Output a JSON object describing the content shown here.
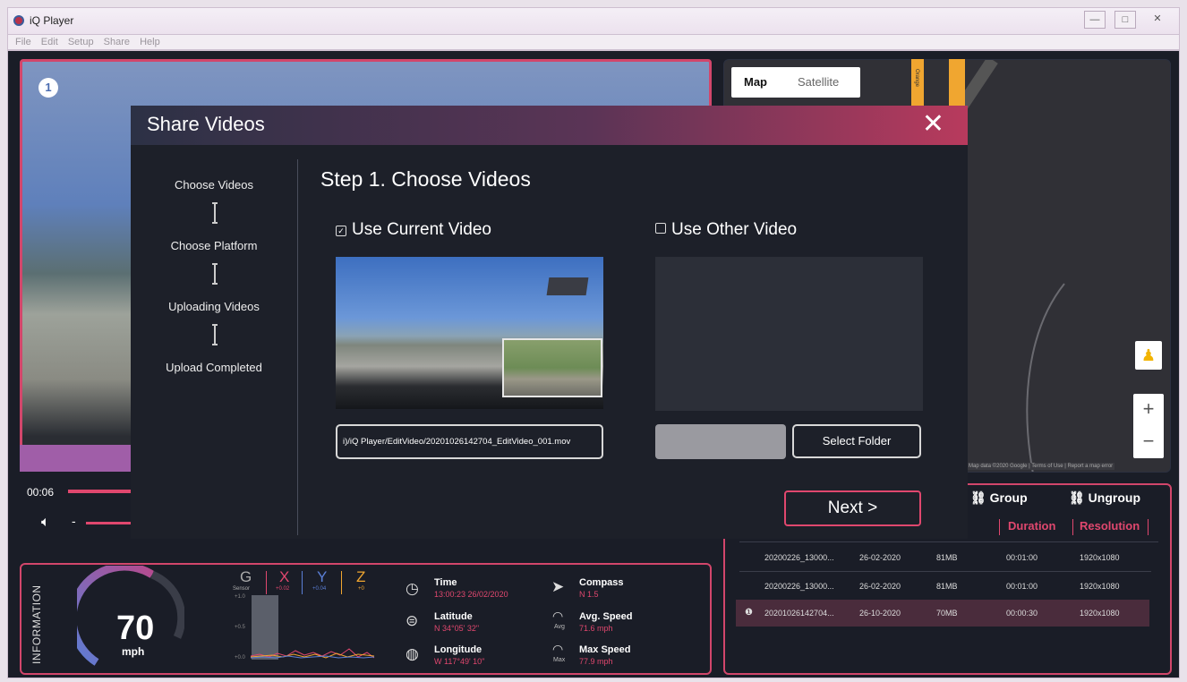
{
  "window": {
    "title": "iQ Player",
    "min": "—",
    "max": "□",
    "close": "✕"
  },
  "menu": [
    "File",
    "Edit",
    "Setup",
    "Share",
    "Help"
  ],
  "video": {
    "camera_number": "1",
    "time": "00:06",
    "volume_dash": "-"
  },
  "map": {
    "tab_map": "Map",
    "tab_satellite": "Satellite",
    "zoom_in": "+",
    "zoom_out": "−",
    "attribution": "Map data ©2020 Google | Terms of Use | Report a map error",
    "road_label": "Orange"
  },
  "modal": {
    "title": "Share Videos",
    "close": "✕",
    "steps": [
      "Choose Videos",
      "Choose Platform",
      "Uploading Videos",
      "Upload Completed"
    ],
    "step_heading": "Step 1. Choose Videos",
    "use_current": "Use Current Video",
    "use_current_checked": true,
    "use_other": "Use Other Video",
    "use_other_checked": false,
    "current_path": "i)/iQ Player/EditVideo/20201026142704_EditVideo_001.mov",
    "select_folder": "Select Folder",
    "next": "Next >"
  },
  "files": {
    "group": "Group",
    "ungroup": "Ungroup",
    "columns": [
      "Duration",
      "Resolution"
    ],
    "rows": [
      {
        "name": "20200226_13000...",
        "date": "26-02-2020",
        "size": "81MB",
        "duration": "00:01:00",
        "resolution": "1920x1080"
      },
      {
        "name": "20200226_13000...",
        "date": "26-02-2020",
        "size": "81MB",
        "duration": "00:01:00",
        "resolution": "1920x1080"
      },
      {
        "name": "20201026142704...",
        "date": "26-10-2020",
        "size": "70MB",
        "duration": "00:00:30",
        "resolution": "1920x1080"
      }
    ]
  },
  "info": {
    "label": "INFORMATION",
    "speed": "70",
    "speed_unit": "mph",
    "g_label": "G",
    "g_sub": "Sensor",
    "x_label": "X",
    "x_val": "+0.02",
    "y_label": "Y",
    "y_val": "+0.04",
    "z_label": "Z",
    "z_val": "+0",
    "ticks": [
      "+1.0",
      "+0.5",
      "+0.0"
    ],
    "time_label": "Time",
    "time_val": "13:00:23  26/02/2020",
    "latitude_label": "Latitude",
    "latitude_val": "N 34°05' 32\"",
    "longitude_label": "Longitude",
    "longitude_val": "W 117°49' 10\"",
    "compass_label": "Compass",
    "compass_val": "N  1.5",
    "avg_speed_label": "Avg. Speed",
    "avg_speed_val": "71.6 mph",
    "avg_mini": "Avg",
    "max_speed_label": "Max Speed",
    "max_speed_val": "77.9 mph",
    "max_mini": "Max"
  },
  "colors": {
    "accent": "#e0476e",
    "background": "#1a1d27",
    "modal": "#1d2029"
  }
}
